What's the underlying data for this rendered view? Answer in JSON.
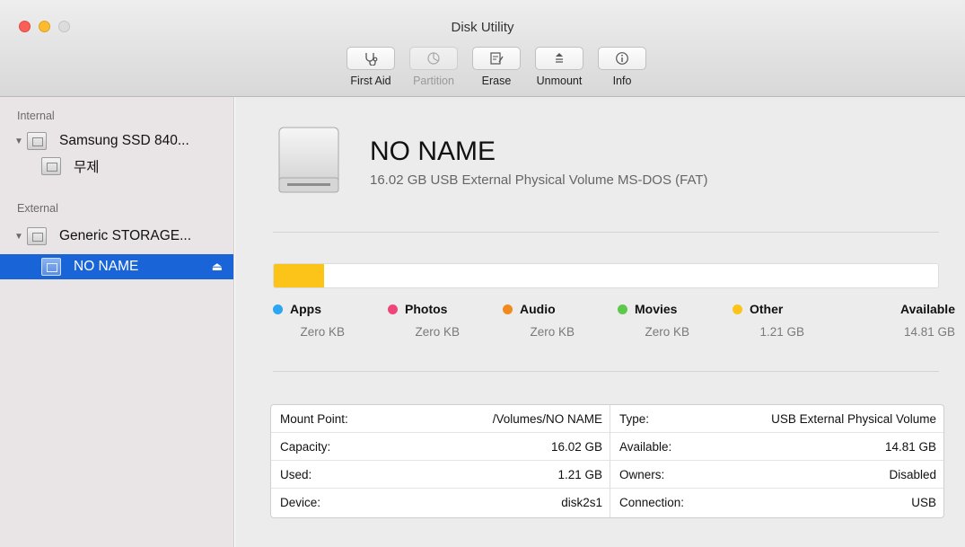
{
  "window": {
    "title": "Disk Utility"
  },
  "toolbar": {
    "items": [
      {
        "label": "First Aid",
        "icon": "stethoscope-icon",
        "enabled": true
      },
      {
        "label": "Partition",
        "icon": "pie-icon",
        "enabled": false
      },
      {
        "label": "Erase",
        "icon": "erase-icon",
        "enabled": true
      },
      {
        "label": "Unmount",
        "icon": "unmount-icon",
        "enabled": true
      },
      {
        "label": "Info",
        "icon": "info-icon",
        "enabled": true
      }
    ]
  },
  "sidebar": {
    "sections": [
      {
        "title": "Internal",
        "items": [
          {
            "label": "Samsung SSD 840...",
            "level": 0,
            "expanded": true
          },
          {
            "label": "무제",
            "level": 1
          }
        ]
      },
      {
        "title": "External",
        "items": [
          {
            "label": "Generic STORAGE...",
            "level": 0,
            "expanded": true
          },
          {
            "label": "NO NAME",
            "level": 1,
            "selected": true,
            "ejectable": true
          }
        ]
      }
    ]
  },
  "volume": {
    "name": "NO NAME",
    "description": "16.02 GB USB External Physical Volume MS-DOS (FAT)"
  },
  "usage": {
    "capacity_gb": 16.02,
    "segments": [
      {
        "name": "Apps",
        "value": "Zero KB",
        "gb": 0,
        "color": "#2aa6f2"
      },
      {
        "name": "Photos",
        "value": "Zero KB",
        "gb": 0,
        "color": "#f0457a"
      },
      {
        "name": "Audio",
        "value": "Zero KB",
        "gb": 0,
        "color": "#f08a1c"
      },
      {
        "name": "Movies",
        "value": "Zero KB",
        "gb": 0,
        "color": "#5cc94a"
      },
      {
        "name": "Other",
        "value": "1.21 GB",
        "gb": 1.21,
        "color": "#fcc419"
      },
      {
        "name": "Available",
        "value": "14.81 GB",
        "gb": 14.81,
        "color": "#ffffff"
      }
    ]
  },
  "details": {
    "left": [
      {
        "key": "Mount Point:",
        "value": "/Volumes/NO NAME"
      },
      {
        "key": "Capacity:",
        "value": "16.02 GB"
      },
      {
        "key": "Used:",
        "value": "1.21 GB"
      },
      {
        "key": "Device:",
        "value": "disk2s1"
      }
    ],
    "right": [
      {
        "key": "Type:",
        "value": "USB External Physical Volume"
      },
      {
        "key": "Available:",
        "value": "14.81 GB"
      },
      {
        "key": "Owners:",
        "value": "Disabled"
      },
      {
        "key": "Connection:",
        "value": "USB"
      }
    ]
  }
}
